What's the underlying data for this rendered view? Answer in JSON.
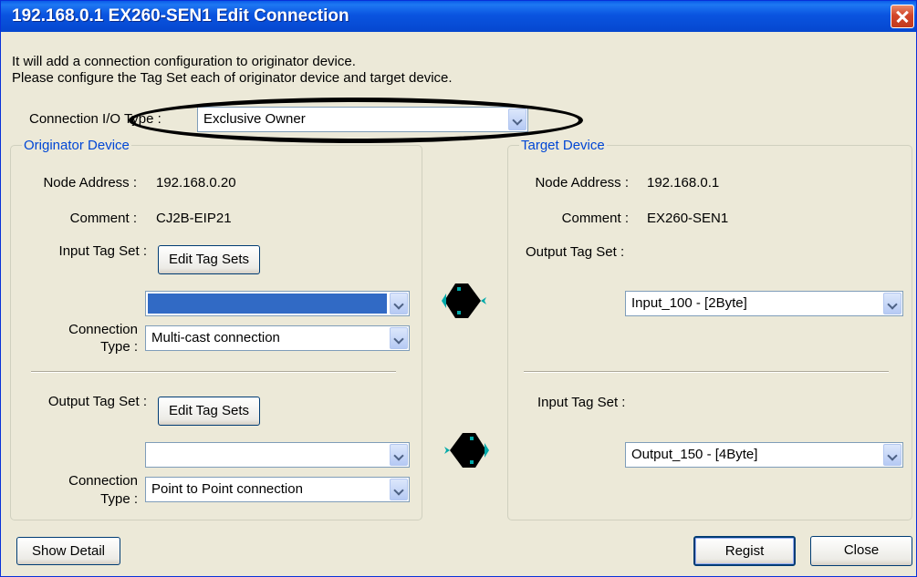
{
  "window": {
    "title": "192.168.0.1 EX260-SEN1 Edit Connection"
  },
  "intro": {
    "line1": "It will add a connection configuration to originator device.",
    "line2": "Please configure the Tag Set each of originator device and target device."
  },
  "connection_io_type": {
    "label": "Connection I/O Type :",
    "value": "Exclusive Owner"
  },
  "originator": {
    "legend": "Originator Device",
    "node_address_label": "Node Address :",
    "node_address": "192.168.0.20",
    "comment_label": "Comment :",
    "comment": "CJ2B-EIP21",
    "input_tag_set_label": "Input Tag Set :",
    "input_edit_button": "Edit Tag Sets",
    "input_tag_value": "",
    "input_connection_type_label_1": "Connection",
    "input_connection_type_label_2": "Type :",
    "input_connection_type": "Multi-cast connection",
    "output_tag_set_label": "Output Tag Set :",
    "output_edit_button": "Edit Tag Sets",
    "output_tag_value": "",
    "output_connection_type_label_1": "Connection",
    "output_connection_type_label_2": "Type :",
    "output_connection_type": "Point to Point connection"
  },
  "target": {
    "legend": "Target Device",
    "node_address_label": "Node Address :",
    "node_address": "192.168.0.1",
    "comment_label": "Comment :",
    "comment": "EX260-SEN1",
    "output_tag_set_label": "Output Tag Set :",
    "output_tag_value": "Input_100 - [2Byte]",
    "input_tag_set_label": "Input Tag Set :",
    "input_tag_value": "Output_150 - [4Byte]"
  },
  "buttons": {
    "show_detail": "Show Detail",
    "regist": "Regist",
    "close": "Close"
  },
  "colors": {
    "title_bar": "#0a54e0",
    "legend": "#0046d5",
    "selection": "#316ac5",
    "dialog_bg": "#ece9d8"
  }
}
